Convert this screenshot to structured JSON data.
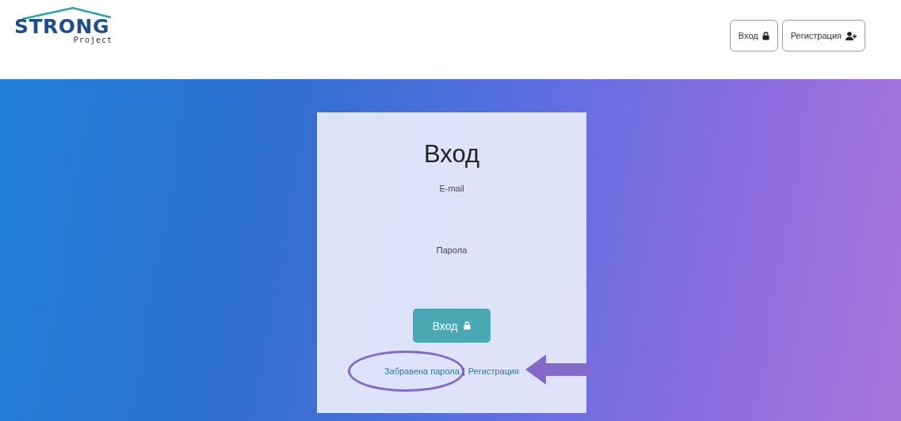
{
  "header": {
    "logo": {
      "title": "STRONG",
      "subtitle": "Project"
    },
    "buttons": [
      {
        "label": "Вход",
        "kind": "lock"
      },
      {
        "label": "Регистрация",
        "kind": "register"
      }
    ]
  },
  "login_card": {
    "title": "Вход",
    "fields": [
      {
        "label": "E-mail"
      },
      {
        "label": "Парола"
      }
    ],
    "submit": {
      "label": "Вход",
      "kind": "lock"
    },
    "links": [
      {
        "label": "Забравена парола"
      },
      {
        "label": "Регистрация"
      }
    ],
    "separator": "|"
  }
}
